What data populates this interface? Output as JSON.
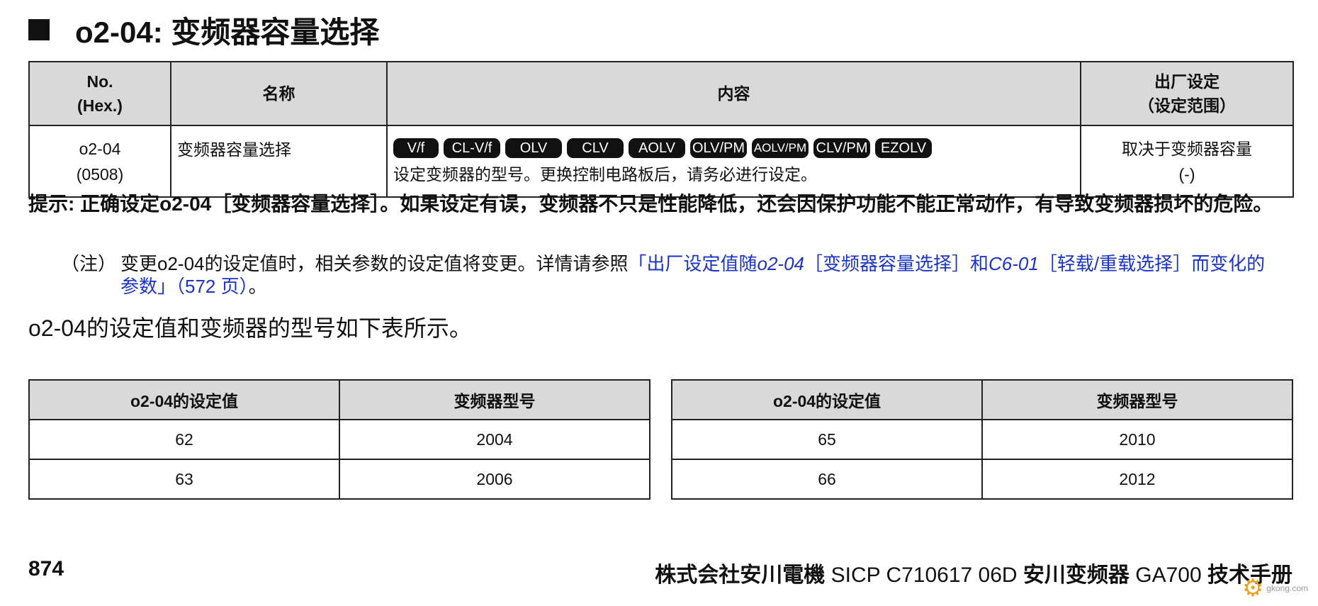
{
  "title": "o2-04: 变频器容量选择",
  "param_table": {
    "headers": {
      "no_line1": "No.",
      "no_line2": "(Hex.)",
      "name": "名称",
      "content": "内容",
      "default_line1": "出厂设定",
      "default_line2": "（设定范围）"
    },
    "row": {
      "no": "o2-04",
      "hex": "(0508)",
      "name": "变频器容量选择",
      "badges": [
        "V/f",
        "CL-V/f",
        "OLV",
        "CLV",
        "AOLV",
        "OLV/PM",
        "AOLV/PM",
        "CLV/PM",
        "EZOLV"
      ],
      "description": "设定变频器的型号。更换控制电路板后，请务必进行设定。",
      "default": "取决于变频器容量",
      "range": "(-)"
    }
  },
  "hint": "提示: 正确设定o2-04［变频器容量选择］。如果设定有误，变频器不只是性能降低，还会因保护功能不能正常动作，有导致变频器损坏的危险。",
  "note": {
    "label": "（注）",
    "text": "变更o2-04的设定值时，相关参数的设定值将变更。详情请参照",
    "link_a": "「出厂设定值随",
    "link_b": "o2-04",
    "link_c": "［变频器容量选择］和",
    "link_d": "C6-01",
    "link_e": "［轻载/重载选择］而变化的参数」（572 页）",
    "tail": "。"
  },
  "lead": "o2-04的设定值和变频器的型号如下表所示。",
  "map_tables": {
    "header_setting": "o2-04的设定值",
    "header_model": "变频器型号",
    "left": [
      {
        "setting": "62",
        "model": "2004"
      },
      {
        "setting": "63",
        "model": "2006"
      }
    ],
    "right": [
      {
        "setting": "65",
        "model": "2010"
      },
      {
        "setting": "66",
        "model": "2012"
      }
    ]
  },
  "footer": {
    "page_number": "874",
    "company": "株式会社安川電機",
    "doc_no": " SICP C710617 06D ",
    "product": "安川变频器",
    "model": " GA700 ",
    "manual": "技术手册"
  },
  "watermark": {
    "text": "gkong.com",
    "icon": "gear-icon"
  }
}
